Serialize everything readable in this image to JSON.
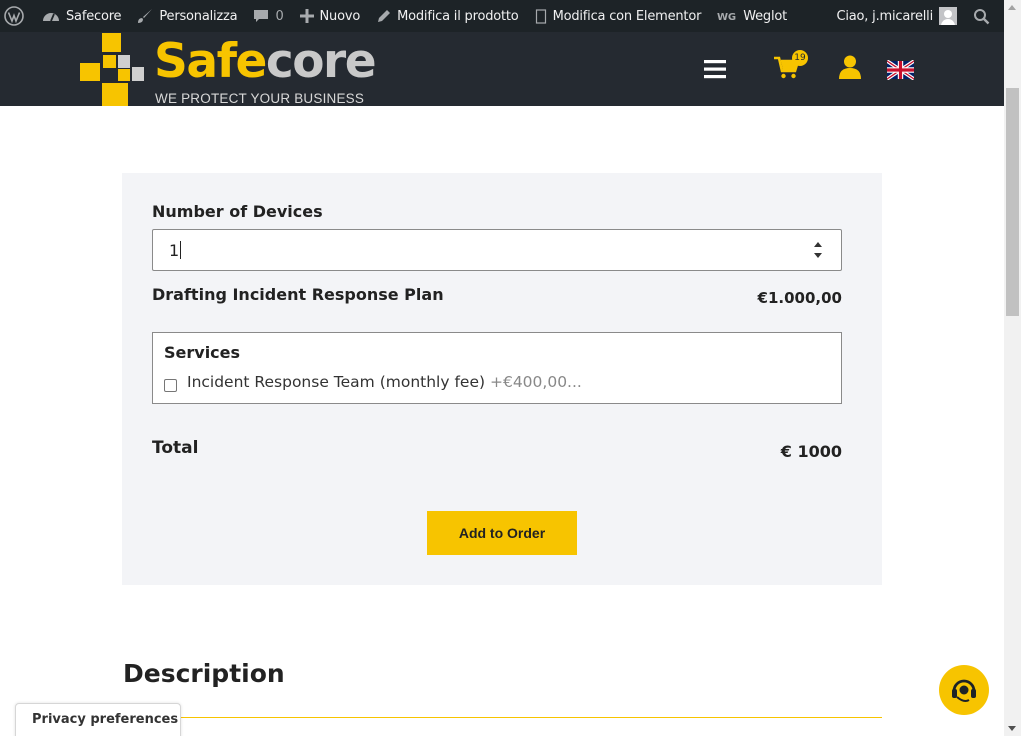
{
  "admin_bar": {
    "site_name": "Safecore",
    "customize": "Personalizza",
    "comments_count": "0",
    "new_label": "Nuovo",
    "edit_product": "Modifica il prodotto",
    "edit_elementor": "Modifica con Elementor",
    "weglot": "Weglot",
    "greeting": "Ciao, j.micarelli"
  },
  "header": {
    "logo_text_safe": "Safe",
    "logo_text_core": "core",
    "logo_tagline": "WE PROTECT YOUR BUSINESS",
    "cart_count": "19",
    "language": "English"
  },
  "form": {
    "devices_label": "Number of Devices",
    "devices_value": "1",
    "plan_label": "Drafting Incident Response Plan",
    "plan_price": "€1.000,00",
    "services_title": "Services",
    "service_item_label": "Incident Response Team (monthly fee)",
    "service_item_price": "+€400,00...",
    "service_item_checked": false,
    "total_label": "Total",
    "total_value": "€ 1000",
    "add_button": "Add to Order"
  },
  "description": {
    "title": "Description"
  },
  "privacy": {
    "label": "Privacy preferences"
  },
  "colors": {
    "brand_yellow": "#f7c400",
    "header_dark": "#252a31",
    "admin_bar": "#1d2327",
    "panel_bg": "#f3f4f7"
  }
}
